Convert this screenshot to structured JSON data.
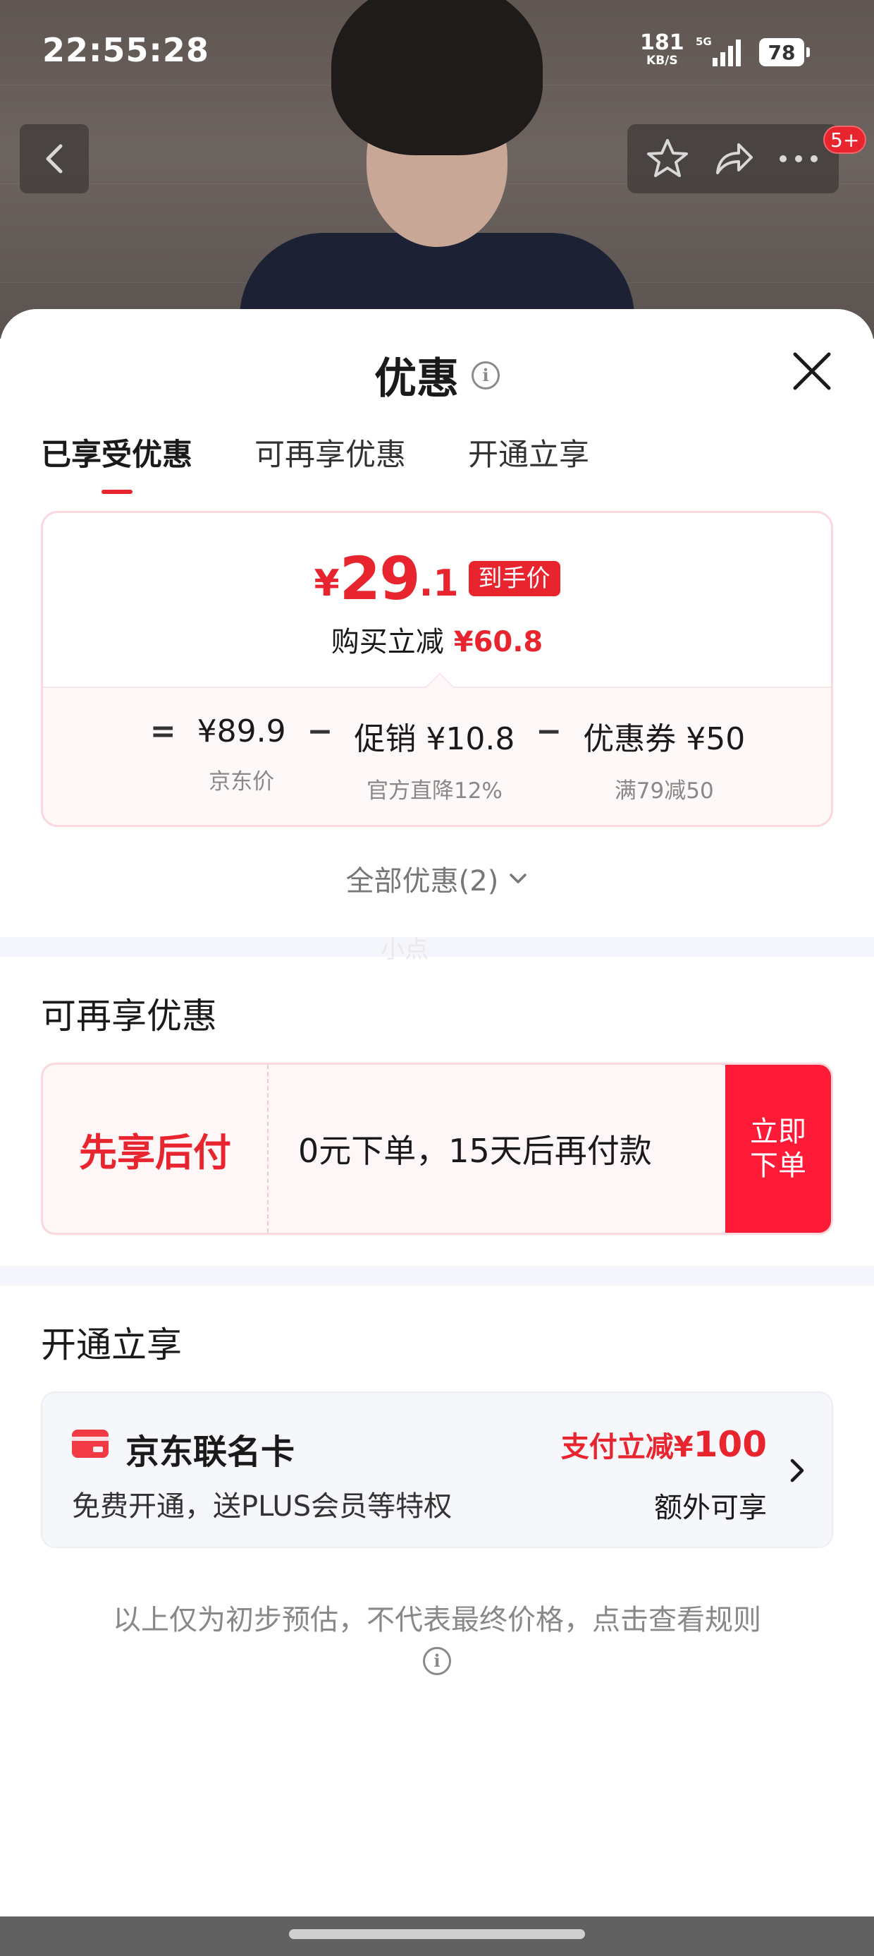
{
  "status_bar": {
    "time": "22:55:28",
    "speed_value": "181",
    "speed_unit": "KB/S",
    "network": "5G",
    "battery": "78"
  },
  "nav": {
    "badge": "5+",
    "icons": [
      "back-icon",
      "star-icon",
      "share-icon",
      "more-icon"
    ]
  },
  "sheet": {
    "title": "优惠",
    "info_symbol": "i",
    "tabs": [
      {
        "label": "已享受优惠",
        "active": true
      },
      {
        "label": "可再享优惠",
        "active": false
      },
      {
        "label": "开通立享",
        "active": false
      }
    ]
  },
  "enjoyed": {
    "currency": "¥",
    "price_int": "29",
    "price_dec": ".1",
    "tag": "到手价",
    "reduce_label": "购买立减",
    "reduce_value": "¥60.8",
    "equals": "=",
    "minus": "−",
    "items": [
      {
        "value": "¥89.9",
        "label": "京东价"
      },
      {
        "value": "促销 ¥10.8",
        "label": "官方直降12%"
      },
      {
        "value": "优惠券 ¥50",
        "label": "满79减50"
      }
    ]
  },
  "all_discounts": "全部优惠(2)",
  "watermark": "小点",
  "reenjoy": {
    "title": "可再享优惠",
    "bnpl_name": "先享后付",
    "bnpl_desc": "0元下单，15天后再付款",
    "bnpl_button": "立即下单"
  },
  "open_enjoy": {
    "title": "开通立享",
    "card_name": "京东联名卡",
    "card_desc": "免费开通，送PLUS会员等特权",
    "benefit_label": "支付立减¥",
    "benefit_value": "100",
    "extra": "额外可享"
  },
  "disclaimer": "以上仅为初步预估，不代表最终价格，点击查看规则",
  "colors": {
    "accent": "#e8252f",
    "button_red": "#ff1a37",
    "card_border": "#fbd8dd"
  }
}
